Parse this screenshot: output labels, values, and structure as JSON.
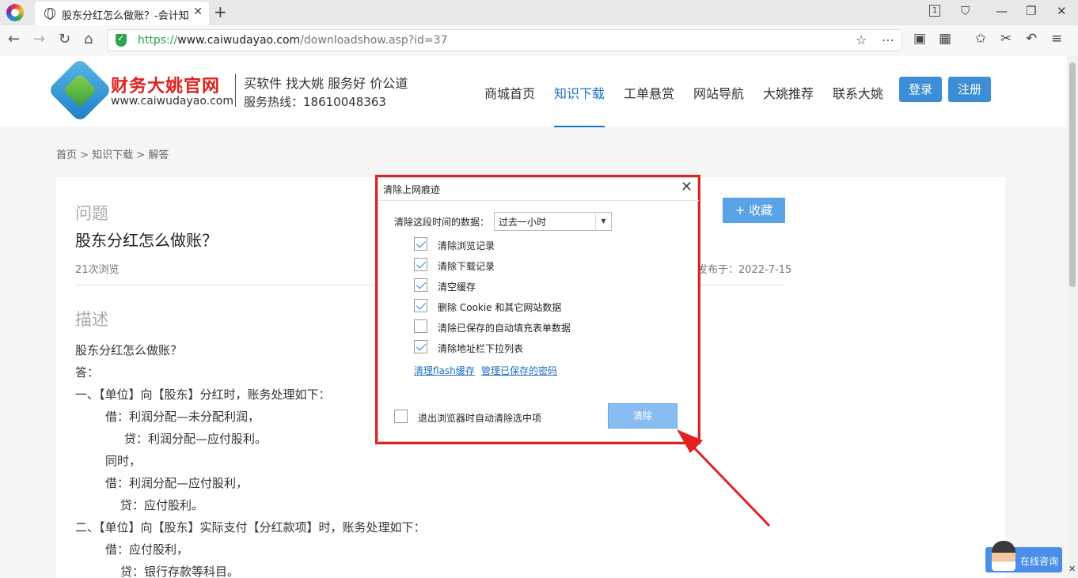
{
  "browser": {
    "tab_title": "股东分红怎么做账？-会计知识",
    "url_scheme": "https://",
    "url_host": "www.caiwudayao.com",
    "url_path": "/downloadshow.asp?id=37",
    "badge": "1"
  },
  "site": {
    "logo_name": "财务大姚官网",
    "logo_url": "www.caiwudayao.com",
    "slogan": "买软件  找大姚  服务好  价公道",
    "hotline": "服务热线：18610048363",
    "nav": [
      "商城首页",
      "知识下载",
      "工单悬赏",
      "网站导航",
      "大姚推荐",
      "联系大姚"
    ],
    "active_nav": "知识下载",
    "login": "登录",
    "register": "注册"
  },
  "breadcrumb": "首页 > 知识下载 > 解答",
  "question": {
    "label": "问题",
    "title": "股东分红怎么做账？",
    "views": "21次浏览",
    "date": "发布于：2022-7-15",
    "fav_button": "+ 收藏"
  },
  "description": {
    "label": "描述",
    "lines": [
      "股东分红怎么做账？",
      "答：",
      "一、【单位】向【股东】分红时，账务处理如下：",
      "借：利润分配—未分配利润，",
      "贷：利润分配—应付股利。",
      "同时，",
      "借：利润分配—应付股利，",
      "贷：应付股利。",
      "二、【单位】向【股东】实际支付【分红款项】时，账务处理如下：",
      "借：应付股利，",
      "贷：银行存款等科目。"
    ]
  },
  "dialog": {
    "title": "清除上网痕迹",
    "range_label": "清除这段时间的数据：",
    "range_value": "过去一小时",
    "options": [
      {
        "label": "清除浏览记录",
        "checked": true
      },
      {
        "label": "清除下载记录",
        "checked": true
      },
      {
        "label": "清空缓存",
        "checked": true
      },
      {
        "label": "删除 Cookie 和其它网站数据",
        "checked": true
      },
      {
        "label": "清除已保存的自动填充表单数据",
        "checked": false
      },
      {
        "label": "清除地址栏下拉列表",
        "checked": true
      }
    ],
    "link_flash": "清理flash缓存",
    "link_passwords": "管理已保存的密码",
    "exit_option": "退出浏览器时自动清除选中项",
    "exit_checked": false,
    "clear_button": "清除"
  },
  "consult": {
    "label": "在线咨询"
  },
  "colors": {
    "brand_red": "#e02020",
    "nav_blue": "#1a73c8",
    "annotation_red": "#e02222"
  }
}
